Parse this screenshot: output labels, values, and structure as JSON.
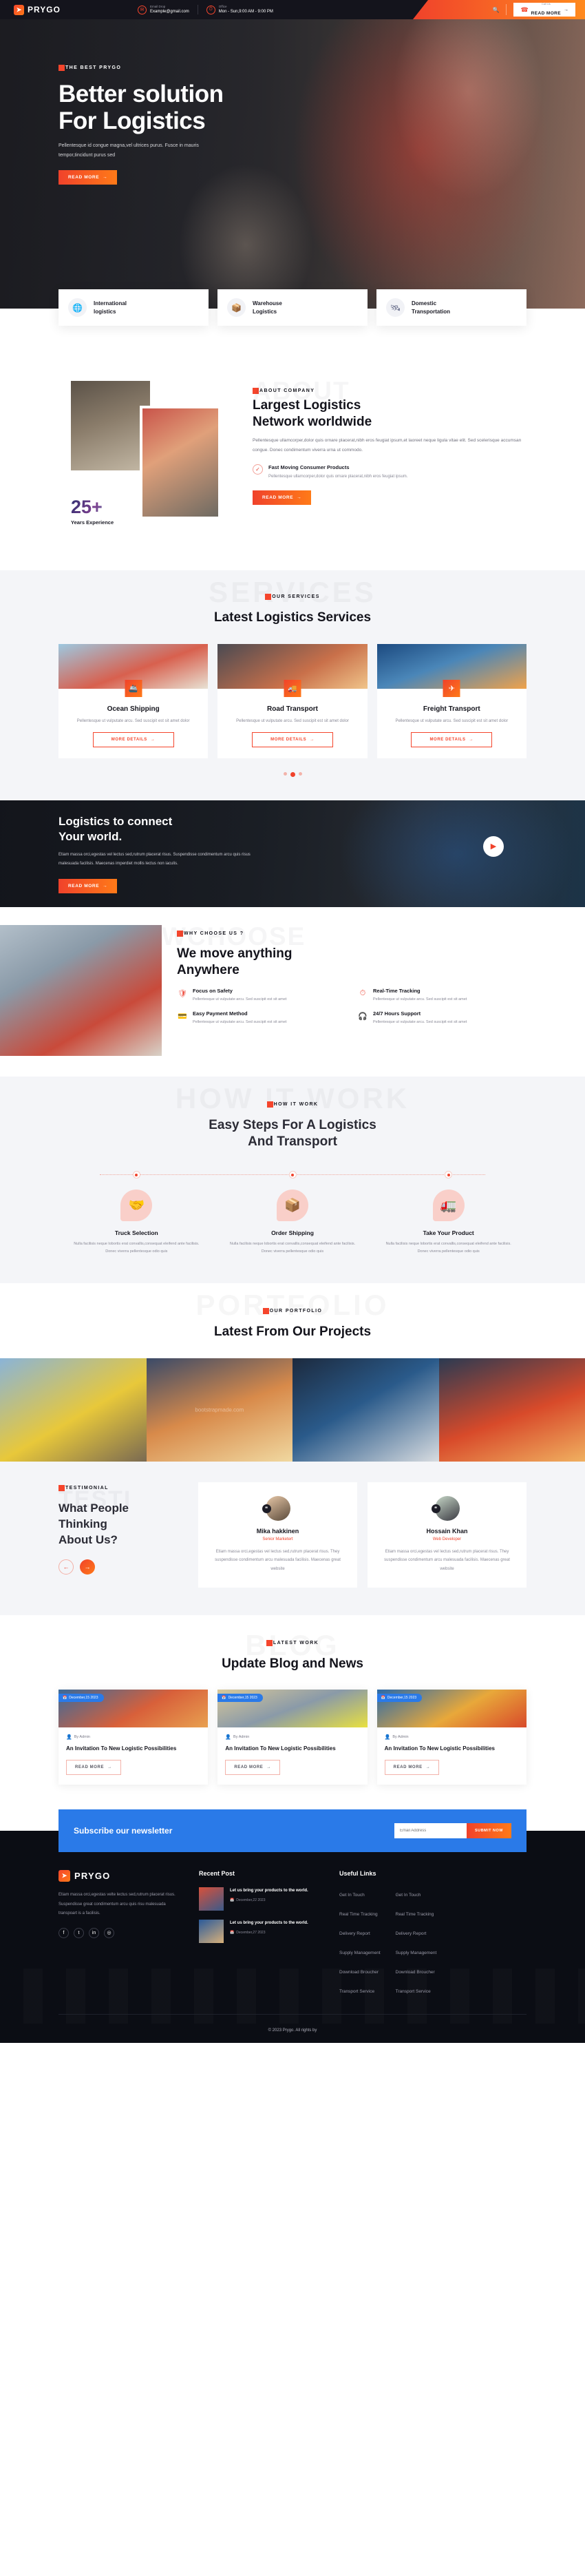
{
  "topbar": {
    "brand": "PRYGO",
    "email_label": "Email Drop",
    "email_value": "Example@gmail.com",
    "office_label": "Office",
    "office_value": "Mon - Sun,9:00 AM - 9:00 PM",
    "search_icon": "search-icon",
    "callus_label": "Call Us",
    "cta_text": "READ MORE"
  },
  "hero": {
    "tag": "THE BEST PRYGO",
    "title_line1": "Better solution",
    "title_line2": "For Logistics",
    "paragraph": "Pellentesque id congue magna,vel ultrices purus. Fusce in mauris tempor,tincidunt purus sed",
    "button": "READ MORE"
  },
  "strip": [
    {
      "title_line1": "International",
      "title_line2": "logistics",
      "icon": "globe-icon"
    },
    {
      "title_line1": "Warehouse",
      "title_line2": "Logistics",
      "icon": "boxes-icon"
    },
    {
      "title_line1": "Domestic",
      "title_line2": "Transportation",
      "icon": "network-globe-icon"
    }
  ],
  "about": {
    "ghost": "ABOUT",
    "tag": "ABOUT COMPANY",
    "title_line1": "Largest Logistics",
    "title_line2": "Network worldwide",
    "paragraph": "Pellentesque ullamcorper,dolor quis ornare placerat,nibh eros feugiat ipsum,et laoreet neque ligula vitae elit. Sed scelerisque accumsan congue. Donec condimentum viverra urna ut commodo.",
    "feature_title": "Fast Moving Consumer Products",
    "feature_text": "Pellentesque ullamcorper,dolor quis ornare placerat,nibh eros feugiat ipsum.",
    "button": "READ MORE",
    "counter_number": "25+",
    "counter_label": "Years Experience"
  },
  "services": {
    "ghost": "SERVICES",
    "tag": "OUR SERVICES",
    "title": "Latest Logistics Services",
    "items": [
      {
        "title": "Ocean Shipping",
        "text": "Pellentesque ut vulputate arcu. Sed suscipit est sit amet dolor",
        "button": "MORE DETAILS",
        "icon": "ship-icon"
      },
      {
        "title": "Road Transport",
        "text": "Pellentesque ut vulputate arcu. Sed suscipit est sit amet dolor",
        "button": "MORE DETAILS",
        "icon": "truck-icon"
      },
      {
        "title": "Freight Transport",
        "text": "Pellentesque ut vulputate arcu. Sed suscipit est sit amet dolor",
        "button": "MORE DETAILS",
        "icon": "plane-icon"
      }
    ]
  },
  "cta_band": {
    "title_line1": "Logistics to connect",
    "title_line2": "Your world.",
    "paragraph": "Etiam massa orci,egestas vel lectus sed,rutrum placerat risus. Suspendisse condimentum arcu quis risus malesuada facilisis. Maecenas imperdiet mollis lectus non iaculis.",
    "button": "READ MORE",
    "play_icon": "play-icon"
  },
  "why": {
    "ghost": "WCHOOSE",
    "tag": "WHY CHOOSE US ?",
    "title_line1": "We move anything",
    "title_line2": "Anywhere",
    "items": [
      {
        "title": "Focus on Safety",
        "text": "Pellentesque ut vulputate arcu. Sed suscipit est sit amet",
        "icon": "safety-box-icon"
      },
      {
        "title": "Real-Time Tracking",
        "text": "Pellentesque ut vulputate arcu. Sed suscipit est sit amet",
        "icon": "tracking-clock-icon"
      },
      {
        "title": "Easy Payment Method",
        "text": "Pellentesque ut vulputate arcu. Sed suscipit est sit amet",
        "icon": "payment-hand-icon"
      },
      {
        "title": "24/7 Hours Support",
        "text": "Pellentesque ut vulputate arcu. Sed suscipit est sit amet",
        "icon": "support-agent-icon"
      }
    ]
  },
  "how": {
    "ghost": "HOW IT WORK",
    "tag": "HOW IT WORK",
    "title_line1": "Easy Steps For A Logistics",
    "title_line2": "And Transport",
    "steps": [
      {
        "title": "Truck Selection",
        "text": "Nulla facilisis neque lobortis erat convallis,consequat eleifend ante facilisis. Donec viverra pellentesque odio quis",
        "icon": "handshake-icon"
      },
      {
        "title": "Order Shipping",
        "text": "Nulla facilisis neque lobortis erat convallis,consequat eleifend ante facilisis. Donec viverra pellentesque odio quis",
        "icon": "package-icon"
      },
      {
        "title": "Take Your Product",
        "text": "Nulla facilisis neque lobortis erat convallis,consequat eleifend ante facilisis. Donec viverra pellentesque odio quis",
        "icon": "delivery-cycle-icon"
      }
    ]
  },
  "portfolio": {
    "ghost": "PORTFOLIO",
    "tag": "OUR PORTFOLIO",
    "title": "Latest From Our Projects",
    "watermark": "bootstrapmade.com",
    "items": [
      "Yellow Truck",
      "Cargo Plane",
      "Container Ship",
      "Highway Transport"
    ]
  },
  "testimonial": {
    "ghost": "TESTI",
    "tag": "TESTIMONIAL",
    "title_line1": "What People",
    "title_line2": "Thinking",
    "title_line3": "About Us?",
    "prev_icon": "arrow-left-icon",
    "next_icon": "arrow-right-icon",
    "cards": [
      {
        "name": "Mika hakkinen",
        "role": "Senior Marketert",
        "text": "Etiam massa orci,egestas vel lectus sed,rutrum placerat risus. They suspendisse condimentum arcu malesuada facilisis. Maecenas great website"
      },
      {
        "name": "Hossain Khan",
        "role": "Web Developer",
        "text": "Etiam massa orci,egestas vel lectus sed,rutrum placerat risus. They suspendisse condimentum arcu malesuada facilisis. Maecenas great website"
      }
    ]
  },
  "blog": {
    "ghost": "BLOG",
    "tag": "LATEST WORK",
    "title": "Update Blog and News",
    "posts": [
      {
        "date": "December,15 2023",
        "author": "By Admin",
        "title": "An Invitation To New Logistic Possibilities",
        "button": "READ MORE"
      },
      {
        "date": "December,15 2023",
        "author": "By Admin",
        "title": "An Invitation To New Logistic Possibilities",
        "button": "READ MORE"
      },
      {
        "date": "December,15 2023",
        "author": "By Admin",
        "title": "An Invitation To New Logistic Possibilities",
        "button": "READ MORE"
      }
    ]
  },
  "newsletter": {
    "title": "Subscribe our newsletter",
    "placeholder": "Email Address",
    "button": "SUBMIT NOW"
  },
  "footer": {
    "brand": "PRYGO",
    "about": "Etiam massa orci,egestas velte lectus sed,rutrum placerat risus. Suspendisse great condimentum arcu quis risu malesuada transpoart is a facilisis.",
    "social": [
      {
        "name": "facebook-icon",
        "glyph": "f"
      },
      {
        "name": "twitter-icon",
        "glyph": "t"
      },
      {
        "name": "linkedin-icon",
        "glyph": "in"
      },
      {
        "name": "instagram-icon",
        "glyph": "◎"
      }
    ],
    "recent_post_heading": "Recent Post",
    "recent_posts": [
      {
        "title": "Let us bring your products to the world.",
        "date": "December,22 2023"
      },
      {
        "title": "Let us bring your products to the world.",
        "date": "December,27 2023"
      }
    ],
    "useful_links_heading": "Useful Links",
    "links_col1": [
      "Get In Touch",
      "Real Time Tracking",
      "Delivery Report",
      "Supply Management",
      "Download Broucher",
      "Transport Service"
    ],
    "links_col2": [
      "Get In Touch",
      "Real Time Tracking",
      "Delivery Report",
      "Supply Management",
      "Download Broucher",
      "Transport Service"
    ],
    "copyright": "© 2023 Prygo. All rights by"
  },
  "colors": {
    "accent_red": "#f0422b",
    "accent_orange": "#ff7a18",
    "dark": "#0b0d14",
    "blue": "#2a7ae8"
  }
}
